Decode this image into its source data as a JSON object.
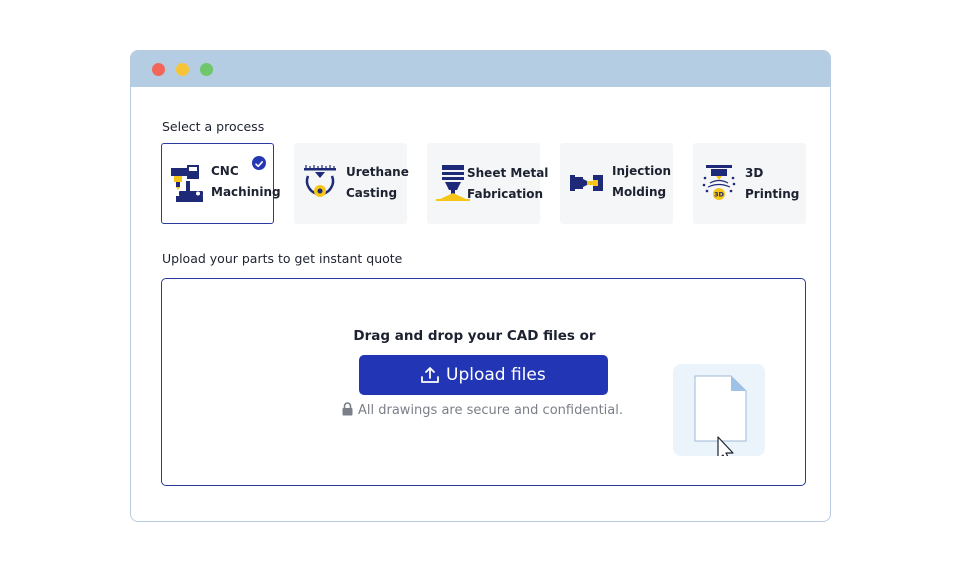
{
  "window": {
    "controls": [
      "close",
      "minimize",
      "maximize"
    ]
  },
  "process": {
    "label": "Select a process",
    "selected": "cnc",
    "cards": [
      {
        "id": "cnc",
        "line1": "CNC",
        "line2": "Machining",
        "icon": "cnc-machine-icon"
      },
      {
        "id": "urethane",
        "line1": "Urethane",
        "line2": "Casting",
        "icon": "urethane-casting-icon"
      },
      {
        "id": "sheet",
        "line1": "Sheet Metal",
        "line2": "Fabrication",
        "icon": "sheet-metal-icon"
      },
      {
        "id": "injection",
        "line1": "Injection",
        "line2": "Molding",
        "icon": "injection-molding-icon"
      },
      {
        "id": "printing",
        "line1": "3D",
        "line2": "Printing",
        "icon": "3d-printer-icon"
      }
    ]
  },
  "upload": {
    "label": "Upload your parts to get instant quote",
    "drag_text": "Drag and drop your CAD files or",
    "button_label": "Upload files",
    "secure_text": "All drawings are secure and confidential.",
    "printer_badge": "3D"
  },
  "colors": {
    "accent": "#2135b5",
    "selected_border": "#2a3b9e",
    "titlebar": "#b5cde2",
    "icon_navy": "#1e2a78",
    "icon_yellow": "#f5c518"
  }
}
